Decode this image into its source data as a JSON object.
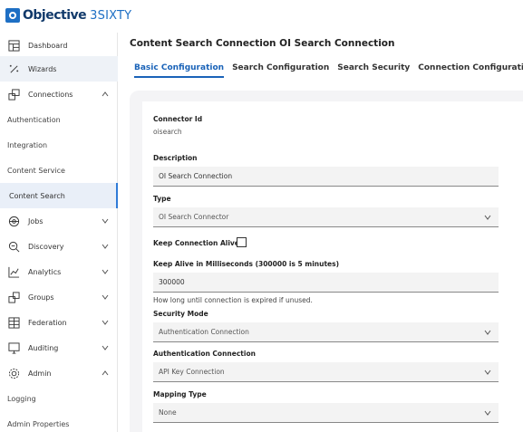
{
  "brand": {
    "name_bold": "Objective",
    "name_light": "3SIXTY"
  },
  "sidebar": {
    "items": [
      {
        "label": "Dashboard",
        "icon": "dashboard-icon"
      },
      {
        "label": "Wizards",
        "icon": "wand-icon"
      },
      {
        "label": "Connections",
        "icon": "connections-icon",
        "expanded": true
      },
      {
        "label": "Authentication"
      },
      {
        "label": "Integration"
      },
      {
        "label": "Content Service"
      },
      {
        "label": "Content Search",
        "selected": true
      },
      {
        "label": "Jobs",
        "icon": "jobs-icon"
      },
      {
        "label": "Discovery",
        "icon": "discovery-icon"
      },
      {
        "label": "Analytics",
        "icon": "analytics-icon"
      },
      {
        "label": "Groups",
        "icon": "groups-icon"
      },
      {
        "label": "Federation",
        "icon": "federation-icon"
      },
      {
        "label": "Auditing",
        "icon": "auditing-icon"
      },
      {
        "label": "Admin",
        "icon": "admin-icon",
        "expanded": true
      },
      {
        "label": "Logging"
      },
      {
        "label": "Admin Properties"
      }
    ]
  },
  "main": {
    "title": "Content Search Connection OI Search Connection",
    "tabs": [
      {
        "label": "Basic Configuration",
        "active": true
      },
      {
        "label": "Search Configuration"
      },
      {
        "label": "Search Security"
      },
      {
        "label": "Connection Configuration"
      }
    ]
  },
  "form": {
    "connector_id_label": "Connector Id",
    "connector_id_value": "oisearch",
    "description_label": "Description",
    "description_value": "OI Search Connection",
    "type_label": "Type",
    "type_value": "OI Search Connector",
    "keep_alive_label": "Keep Connection Alive:",
    "keep_alive_checked": false,
    "keep_alive_ms_label": "Keep Alive in Milliseconds (300000 is 5 minutes)",
    "keep_alive_ms_value": "300000",
    "keep_alive_ms_help": "How long until connection is expired if unused.",
    "security_mode_label": "Security Mode",
    "security_mode_value": "Authentication Connection",
    "auth_connection_label": "Authentication Connection",
    "auth_connection_value": "API Key Connection",
    "mapping_type_label": "Mapping Type",
    "mapping_type_value": "None"
  },
  "colors": {
    "accent": "#1a63b8",
    "brand_dark": "#123a6b",
    "selected_bg": "#e9eff8"
  }
}
